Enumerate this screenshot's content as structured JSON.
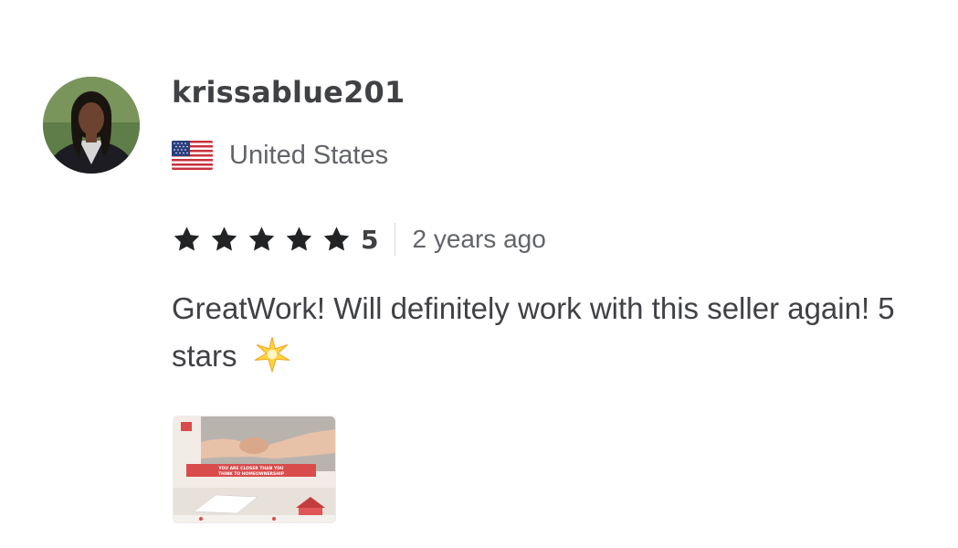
{
  "review": {
    "username": "krissablue201",
    "country": "United States",
    "country_flag_icon": "us-flag-icon",
    "rating": {
      "value": "5",
      "stars_filled": 5,
      "stars_total": 5,
      "star_color": "#222325"
    },
    "time_ago": "2 years ago",
    "text": "GreatWork! Will definitely work with this seller again! 5 stars",
    "text_emoji_icon": "sparkle-star-icon",
    "attachment": {
      "banner_text": "YOU ARE CLOSER THAN YOU THINK TO HOMEOWNERSHIP"
    }
  }
}
